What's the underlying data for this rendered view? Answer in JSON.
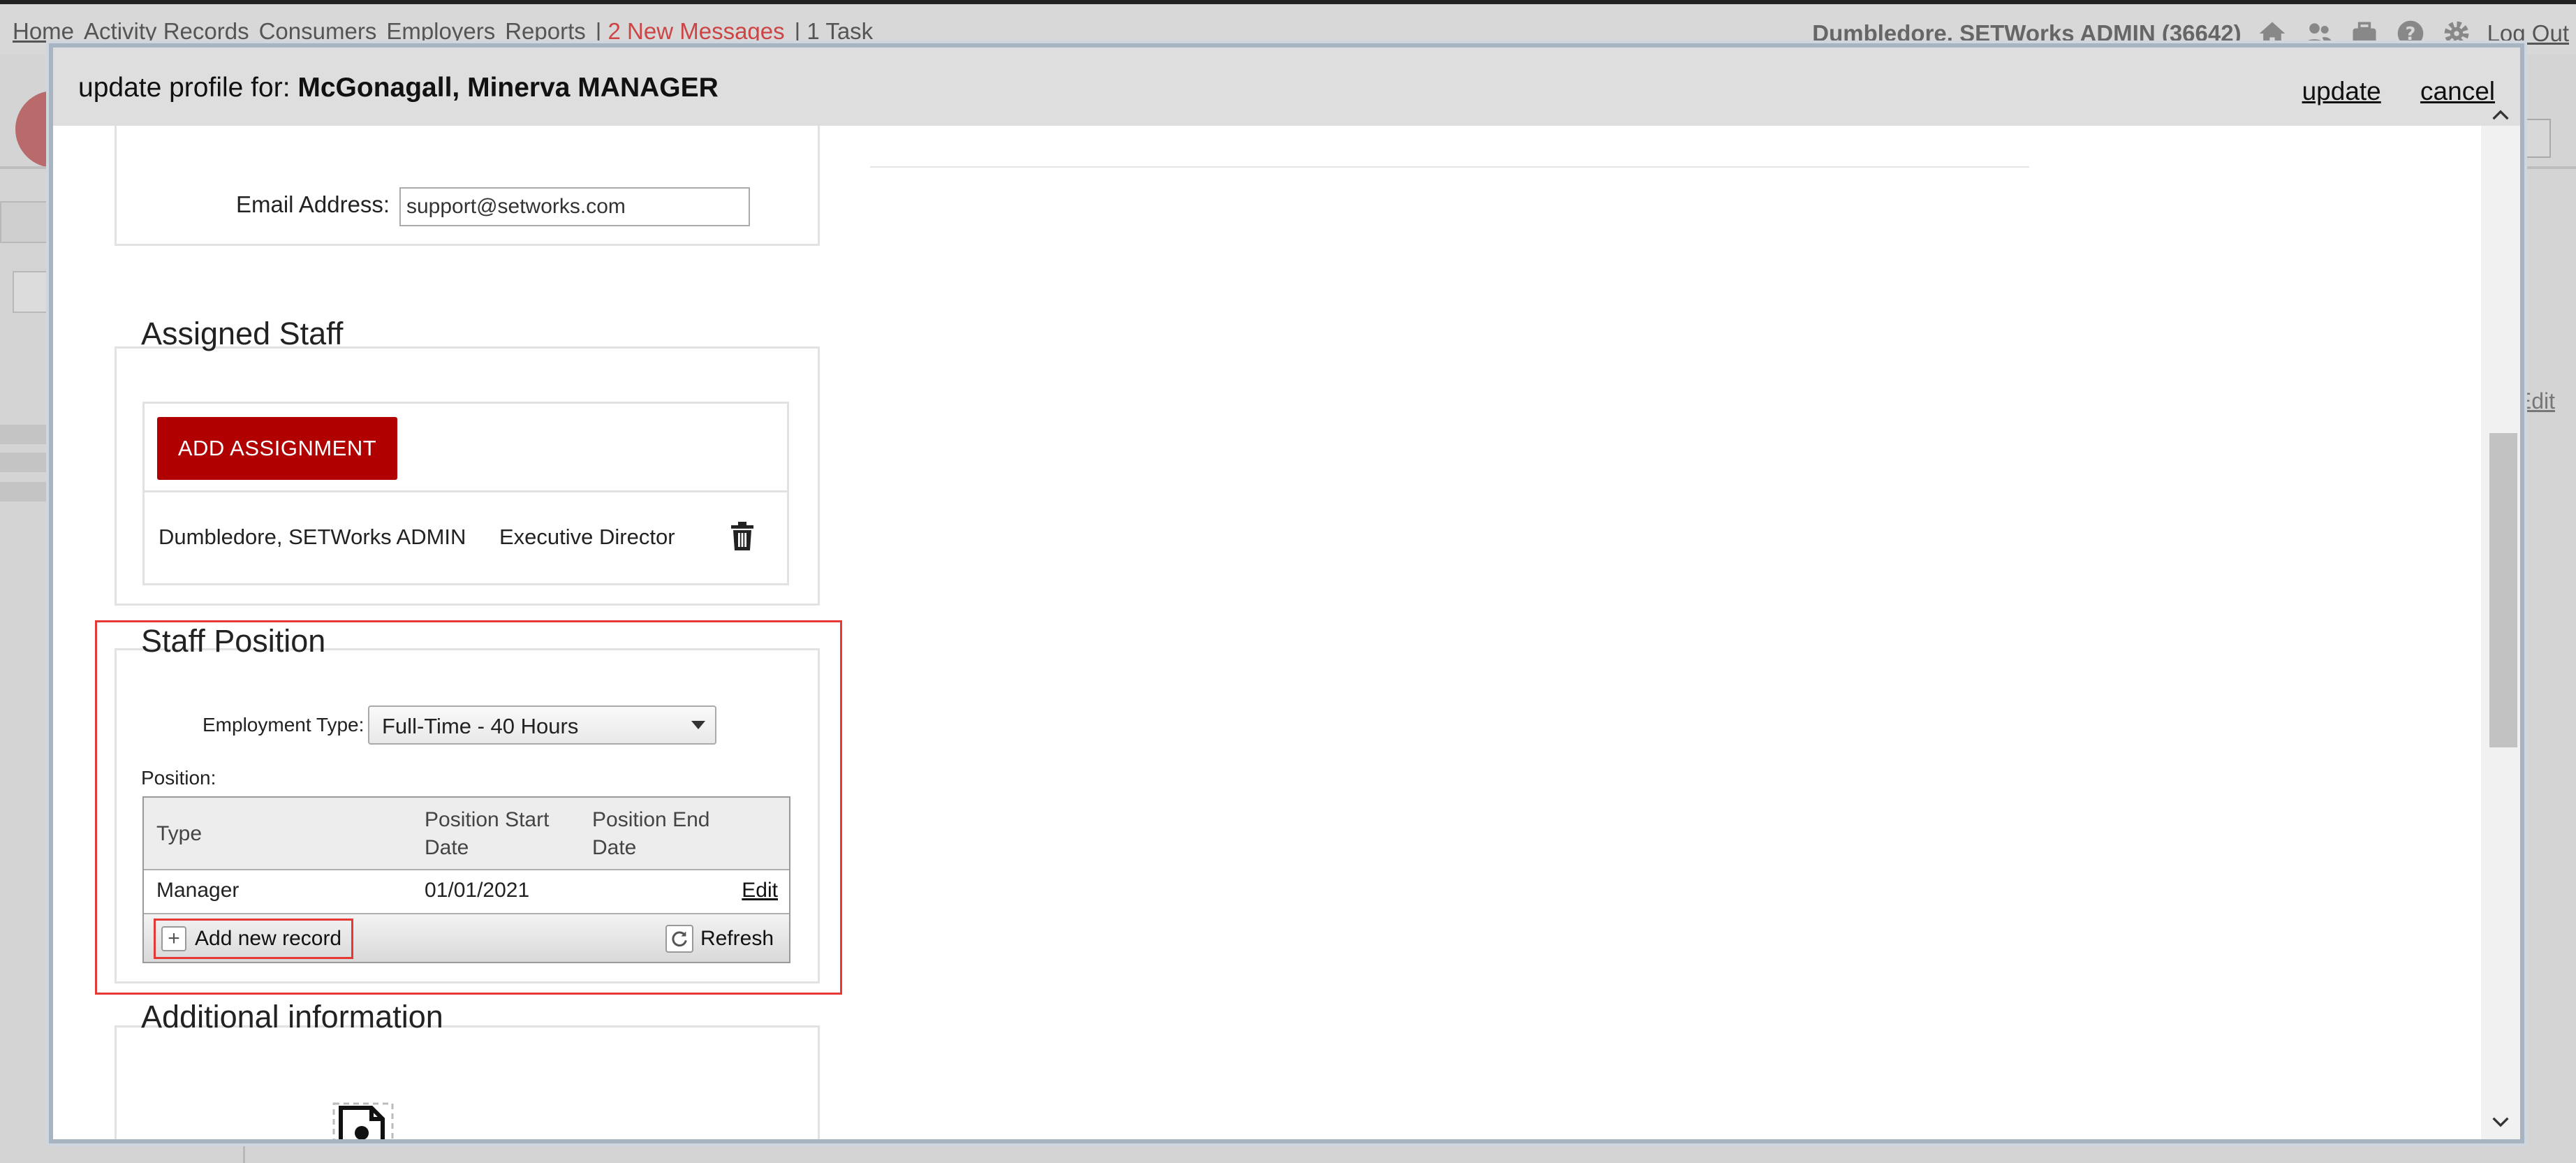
{
  "top_nav": {
    "links": [
      "Home",
      "Activity Records",
      "Consumers",
      "Employers",
      "Reports"
    ],
    "separator": "|",
    "messages": "2 New Messages",
    "tasks": "1 Task",
    "user": "Dumbledore, SETWorks ADMIN",
    "user_id": "(36642)",
    "logout": "Log Out",
    "icons": [
      "home-icon",
      "people-icon",
      "briefcase-icon",
      "help-icon",
      "gear-icon"
    ]
  },
  "background": {
    "edit_link": "Edit"
  },
  "modal": {
    "title_prefix": "update profile for:",
    "title_name": "McGonagall, Minerva MANAGER",
    "update": "update",
    "cancel": "cancel"
  },
  "email": {
    "label": "Email Address:",
    "value": "support@setworks.com"
  },
  "assigned_staff": {
    "title": "Assigned Staff",
    "add_button": "ADD ASSIGNMENT",
    "assignments": [
      {
        "name": "Dumbledore, SETWorks ADMIN",
        "role": "Executive Director"
      }
    ]
  },
  "staff_position": {
    "title": "Staff Position",
    "employment_type_label": "Employment Type:",
    "employment_type_value": "Full-Time - 40 Hours",
    "position_label": "Position:",
    "columns": [
      "Type",
      "Position Start Date",
      "Position End Date"
    ],
    "rows": [
      {
        "type": "Manager",
        "start": "01/01/2021",
        "end": "",
        "action": "Edit"
      }
    ],
    "add_new_record": "Add new record",
    "refresh": "Refresh"
  },
  "additional_info": {
    "title": "Additional information"
  },
  "colors": {
    "accent_red": "#b00000",
    "highlight_red": "#e53935",
    "header_gray": "#dedede"
  }
}
